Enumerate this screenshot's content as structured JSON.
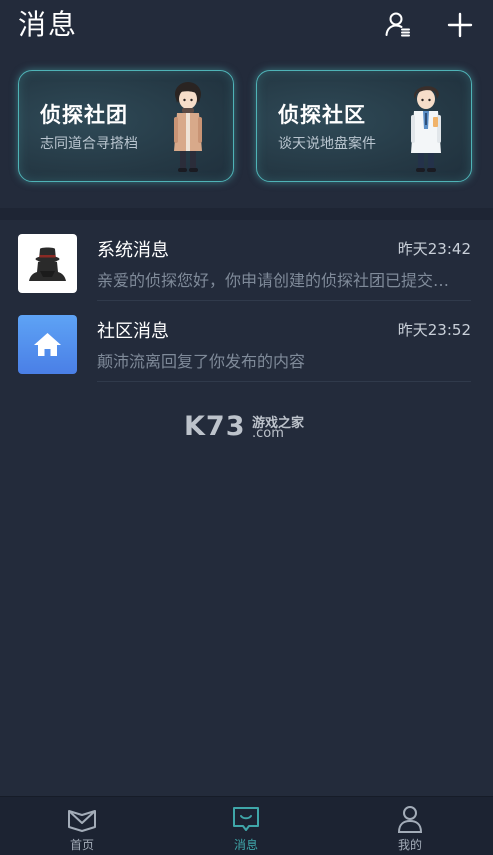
{
  "header": {
    "title": "消息",
    "icons": [
      "contacts-icon",
      "plus-icon"
    ]
  },
  "cards": [
    {
      "title": "侦探社团",
      "subtitle": "志同道合寻搭档",
      "figure": "detective-character-coat"
    },
    {
      "title": "侦探社区",
      "subtitle": "谈天说地盘案件",
      "figure": "detective-character-labcoat"
    }
  ],
  "messages": [
    {
      "name": "系统消息",
      "time": "昨天23:42",
      "preview": "亲爱的侦探您好，你申请创建的侦探社团已提交…",
      "avatar": "detective-hat-icon"
    },
    {
      "name": "社区消息",
      "time": "昨天23:52",
      "preview": "颠沛流离回复了你发布的内容",
      "avatar": "home-icon"
    }
  ],
  "watermark": {
    "brand": "K73",
    "cn": "游戏之家",
    "domain": ".com"
  },
  "tabbar": {
    "active_index": 1,
    "items": [
      {
        "label": "首页",
        "icon": "home-book-icon"
      },
      {
        "label": "消息",
        "icon": "message-icon"
      },
      {
        "label": "我的",
        "icon": "profile-icon"
      }
    ]
  },
  "colors": {
    "background": "#232b3b",
    "card_border": "#4fb3b7",
    "accent": "#3fa6a9",
    "tabbar": "#1c2332",
    "system_avatar_bg": "#ffffff",
    "community_avatar_bg": "#4f8ef0"
  }
}
